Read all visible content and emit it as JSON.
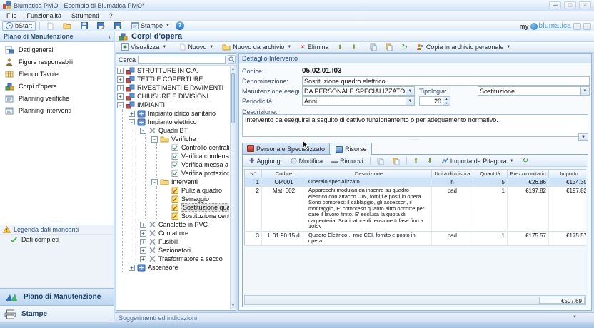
{
  "window": {
    "title": "Blumatica PMO - Esempio di Blumatica PMO*",
    "menu": [
      "File",
      "Funzionalità",
      "Strumenti",
      "?"
    ],
    "toolbar": {
      "bstart": "bStart",
      "stampe": "Stampe"
    },
    "brand": {
      "prefix": "my",
      "name": "blumatica"
    }
  },
  "sidebar": {
    "header": "Piano di Manutenzione",
    "items": [
      {
        "label": "Dati generali",
        "icon": "general-data-icon"
      },
      {
        "label": "Figure responsabili",
        "icon": "responsible-figures-icon"
      },
      {
        "label": "Elenco Tavole",
        "icon": "tables-list-icon"
      },
      {
        "label": "Corpi d'opera",
        "icon": "works-icon"
      },
      {
        "label": "Planning verifiche",
        "icon": "planning-checks-icon"
      },
      {
        "label": "Planning interventi",
        "icon": "planning-interventions-icon"
      }
    ],
    "legend": {
      "header": "Legenda dati mancanti",
      "items": [
        {
          "label": "Dati completi",
          "icon": "green-check-icon"
        }
      ]
    },
    "sections": [
      {
        "label": "Piano di Manutenzione",
        "icon": "maintenance-plan-icon",
        "active": true
      },
      {
        "label": "Stampe",
        "icon": "prints-icon",
        "active": false
      }
    ]
  },
  "main": {
    "page_title": "Corpi d'opera",
    "toolbar": {
      "visualizza": "Visualizza",
      "nuovo": "Nuovo",
      "nuovo_da_archivio": "Nuovo da archivio",
      "elimina": "Elimina",
      "copia_archivio": "Copia in archivio personale"
    },
    "search_label": "Cerca",
    "search_value": "",
    "tree": [
      {
        "label": "STRUTTURE IN C.A.",
        "icon": "building-icon",
        "state": "plus"
      },
      {
        "label": "TETTI E COPERTURE",
        "icon": "building-icon",
        "state": "plus"
      },
      {
        "label": "RIVESTIMENTI E PAVIMENTI",
        "icon": "building-icon",
        "state": "plus"
      },
      {
        "label": "CHIUSURE E DIVISIONI",
        "icon": "building-icon",
        "state": "plus"
      },
      {
        "label": "IMPIANTI",
        "icon": "building-icon",
        "state": "minus",
        "children": [
          {
            "label": "Impianto idrico sanitario",
            "icon": "system-icon",
            "state": "plus"
          },
          {
            "label": "Impianto elettrico",
            "icon": "system-icon",
            "state": "minus",
            "children": [
              {
                "label": "Quadri BT",
                "icon": "component-icon",
                "state": "minus",
                "children": [
                  {
                    "label": "Verifiche",
                    "icon": "folder-icon",
                    "state": "minus",
                    "children": [
                      {
                        "label": "Controllo centralina",
                        "icon": "check-task-icon",
                        "state": "leaf"
                      },
                      {
                        "label": "Verifica condensatori",
                        "icon": "check-task-icon",
                        "state": "leaf"
                      },
                      {
                        "label": "Verifica messa a terra",
                        "icon": "check-task-icon",
                        "state": "leaf"
                      },
                      {
                        "label": "Verifica protezioni",
                        "icon": "check-task-icon",
                        "state": "leaf"
                      }
                    ]
                  },
                  {
                    "label": "Interventi",
                    "icon": "folder-icon",
                    "state": "minus",
                    "children": [
                      {
                        "label": "Pulizia quadro",
                        "icon": "intervention-icon",
                        "state": "leaf"
                      },
                      {
                        "label": "Serraggio",
                        "icon": "intervention-icon",
                        "state": "leaf"
                      },
                      {
                        "label": "Sostituzione quadro elettrico",
                        "icon": "intervention-icon",
                        "state": "leaf",
                        "selected": true
                      },
                      {
                        "label": "Sostituzione centralina",
                        "icon": "intervention-icon",
                        "state": "leaf"
                      }
                    ]
                  }
                ]
              },
              {
                "label": "Canalette in PVC",
                "icon": "component-icon",
                "state": "plus"
              },
              {
                "label": "Contattore",
                "icon": "component-icon",
                "state": "plus"
              },
              {
                "label": "Fusibili",
                "icon": "component-icon",
                "state": "plus"
              },
              {
                "label": "Sezionatori",
                "icon": "component-icon",
                "state": "plus"
              },
              {
                "label": "Trasformatore a secco",
                "icon": "component-icon",
                "state": "plus"
              }
            ]
          },
          {
            "label": "Ascensore",
            "icon": "system-icon",
            "state": "plus"
          }
        ]
      }
    ],
    "detail": {
      "header": "Dettaglio Intervento",
      "fields": {
        "codice_label": "Codice:",
        "codice": "05.02.01.I03",
        "denominazione_label": "Denominazione:",
        "denominazione": "Sostituzione quadro elettrico",
        "manutenzione_label": "Manutenzione eseguibile:",
        "manutenzione": "DA PERSONALE SPECIALIZZATO",
        "tipologia_label": "Tipologia:",
        "tipologia": "Sostituzione",
        "periodicita_label": "Periodicità:",
        "periodicita": "Anni",
        "periodicita_valore": "20",
        "descrizione_label": "Descrizione:",
        "descrizione": "Intervento da eseguirsi a seguito di cattivo funzionamento o per adeguamento normativo."
      },
      "tabs": [
        {
          "label": "Personale Specializzato",
          "active": false
        },
        {
          "label": "Risorse",
          "active": true
        }
      ],
      "grid_toolbar": {
        "aggiungi": "Aggiungi",
        "modifica": "Modifica",
        "rimuovi": "Rimuovi",
        "importa": "Importa da Pitagora"
      },
      "table": {
        "columns": [
          "N°",
          "Codice",
          "Descrizione",
          "Unità di misura",
          "Quantità",
          "Prezzo unitario",
          "Importo"
        ],
        "rows": [
          {
            "n": "1",
            "codice": "OP.001",
            "descrizione": "Operaio specializzato",
            "unita": "h",
            "quantita": "5",
            "prezzo": "€26.86",
            "importo": "€134.30",
            "selected": true
          },
          {
            "n": "2",
            "codice": "Mat. 002",
            "descrizione": "Apparecchi modulari da inserire su quadro elettrico con attacco DIN, forniti e posti in opera. Sono compresi: il cablaggio, gli accessori, il montaggio, E' compreso quanto altro occorre per dare il lavoro finito. E' esclusa la quota di carpenteria. Scaricatore di tensione trifase fino a 10kA",
            "unita": "cad",
            "quantita": "1",
            "prezzo": "€197.82",
            "importo": "€197.82",
            "selected": false
          },
          {
            "n": "3",
            "codice": "L.01.90.15.d",
            "descrizione": "Quadro Elettrico .. rme CEI, fornito e posto in opera",
            "unita": "cad",
            "quantita": "1",
            "prezzo": "€175.57",
            "importo": "€175.57",
            "selected": false
          }
        ],
        "total": "€507.69"
      }
    },
    "statusbar": "Suggerimenti ed indicazioni"
  }
}
